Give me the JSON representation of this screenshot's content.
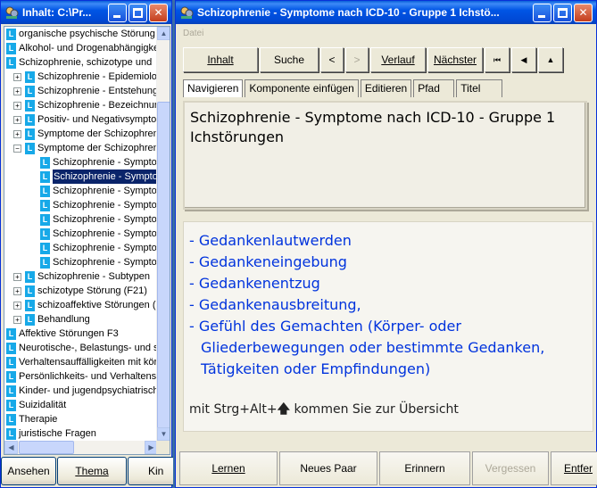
{
  "left_window": {
    "title": "Inhalt: C:\\Pr...",
    "tree": [
      {
        "label": "organische psychische Störung",
        "kind": "leaf"
      },
      {
        "label": "Alkohol- und Drogenabhängigke",
        "kind": "leaf"
      },
      {
        "label": "Schizophrenie, schizotype und",
        "kind": "leaf"
      },
      {
        "label": "Schizophrenie - Epidemiolog",
        "kind": "plus"
      },
      {
        "label": "Schizophrenie - Entstehung",
        "kind": "plus"
      },
      {
        "label": "Schizophrenie - Bezeichnun",
        "kind": "plus"
      },
      {
        "label": "Positiv- und Negativsympto",
        "kind": "plus"
      },
      {
        "label": "Symptome der Schizophren",
        "kind": "plus"
      },
      {
        "label": "Symptome der Schizophren",
        "kind": "minus"
      },
      {
        "label": "Schizophrenie - Sympto",
        "kind": "child"
      },
      {
        "label": "Schizophrenie - Sympto",
        "kind": "child-selected"
      },
      {
        "label": "Schizophrenie - Sympto",
        "kind": "child"
      },
      {
        "label": "Schizophrenie - Sympto",
        "kind": "child"
      },
      {
        "label": "Schizophrenie - Sympto",
        "kind": "child"
      },
      {
        "label": "Schizophrenie - Sympto",
        "kind": "child"
      },
      {
        "label": "Schizophrenie - Sympto",
        "kind": "child"
      },
      {
        "label": "Schizophrenie - Sympto",
        "kind": "child"
      },
      {
        "label": "Schizophrenie - Subtypen",
        "kind": "plus"
      },
      {
        "label": "schizotype Störung (F21)",
        "kind": "plus"
      },
      {
        "label": "schizoaffektive Störungen (",
        "kind": "plus"
      },
      {
        "label": "Behandlung",
        "kind": "plus"
      },
      {
        "label": "Affektive Störungen F3",
        "kind": "root"
      },
      {
        "label": "Neurotische-, Belastungs- und s",
        "kind": "root"
      },
      {
        "label": "Verhaltensauffälligkeiten mit kör",
        "kind": "root"
      },
      {
        "label": "Persönlichkeits- und Verhaltens",
        "kind": "root"
      },
      {
        "label": "Kinder- und jugendpsychiatrisch",
        "kind": "root"
      },
      {
        "label": "Suizidalität",
        "kind": "root"
      },
      {
        "label": "Therapie",
        "kind": "root"
      },
      {
        "label": "juristische Fragen",
        "kind": "root"
      }
    ],
    "buttons": [
      "Ansehen",
      "Thema",
      "Kin"
    ]
  },
  "right_window": {
    "title": "Schizophrenie - Symptome nach ICD-10 - Gruppe 1 Ichstö...",
    "menu": "Datei",
    "nav": {
      "inhalt": "Inhalt",
      "suche": "Suche",
      "prev": "<",
      "next": ">",
      "verlauf": "Verlauf",
      "naechster": "Nächster",
      "first": "⏮",
      "back": "◀",
      "up": "▲"
    },
    "tabs": [
      "Navigieren",
      "Komponente einfügen",
      "Editieren",
      "Pfad",
      "Titel"
    ],
    "topic_title": "Schizophrenie - Symptome nach ICD-10 - Gruppe 1 Ichstörungen",
    "items": [
      "- Gedankenlautwerden",
      "- Gedankeneingebung",
      "- Gedankenentzug",
      "- Gedankenausbreitung,",
      "- Gefühl des Gemachten (Körper- oder"
    ],
    "item_continuation": [
      "Gliederbewegungen oder bestimmte Gedanken,",
      "Tätigkeiten oder Empfindungen)"
    ],
    "footer_before": "mit Strg+Alt+",
    "footer_after": " kommen Sie zur Übersicht",
    "bottom_buttons": {
      "lernen": "Lernen",
      "neues_paar": "Neues Paar",
      "erinnern": "Erinnern",
      "vergessen": "Vergessen",
      "entfernen": "Entfer"
    }
  }
}
